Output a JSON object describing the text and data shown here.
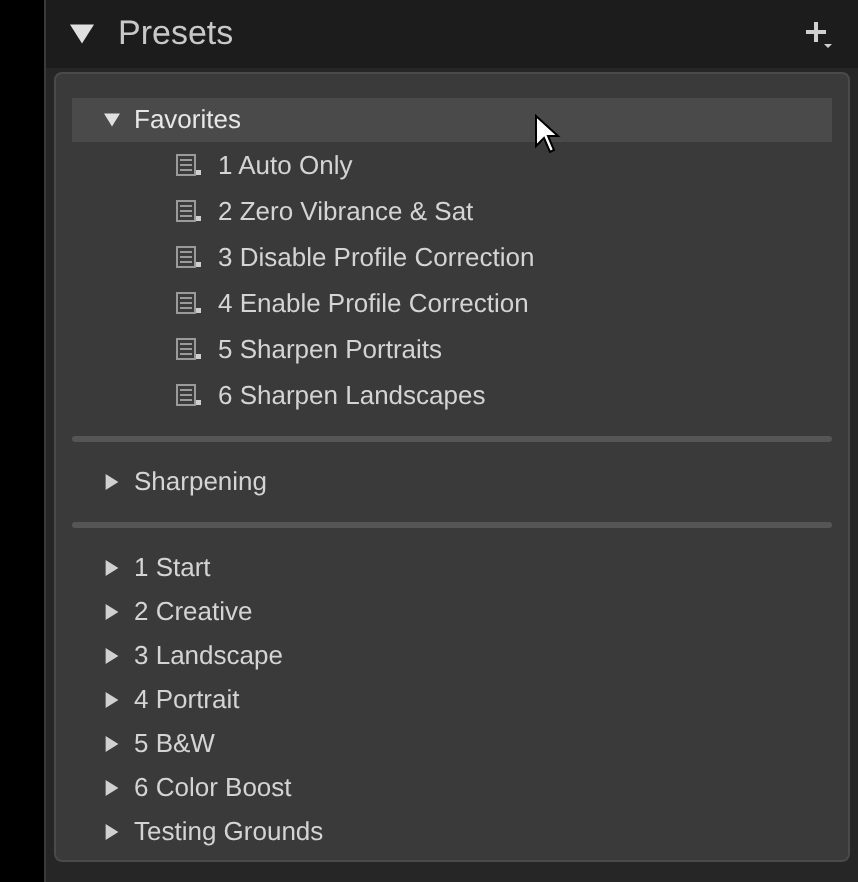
{
  "panel": {
    "title": "Presets",
    "expanded": true
  },
  "sections": [
    {
      "folders": [
        {
          "name": "Favorites",
          "expanded": true,
          "selected": true,
          "presets": [
            {
              "name": "1 Auto Only"
            },
            {
              "name": "2 Zero Vibrance & Sat"
            },
            {
              "name": "3 Disable Profile Correction"
            },
            {
              "name": "4 Enable Profile Correction"
            },
            {
              "name": "5 Sharpen Portraits"
            },
            {
              "name": "6 Sharpen Landscapes"
            }
          ]
        }
      ]
    },
    {
      "folders": [
        {
          "name": "Sharpening",
          "expanded": false,
          "selected": false
        }
      ]
    },
    {
      "folders": [
        {
          "name": "1 Start",
          "expanded": false,
          "selected": false
        },
        {
          "name": "2 Creative",
          "expanded": false,
          "selected": false
        },
        {
          "name": "3 Landscape",
          "expanded": false,
          "selected": false
        },
        {
          "name": "4 Portrait",
          "expanded": false,
          "selected": false
        },
        {
          "name": "5 B&W",
          "expanded": false,
          "selected": false
        },
        {
          "name": "6 Color Boost",
          "expanded": false,
          "selected": false
        },
        {
          "name": "Testing Grounds",
          "expanded": false,
          "selected": false
        }
      ]
    }
  ]
}
